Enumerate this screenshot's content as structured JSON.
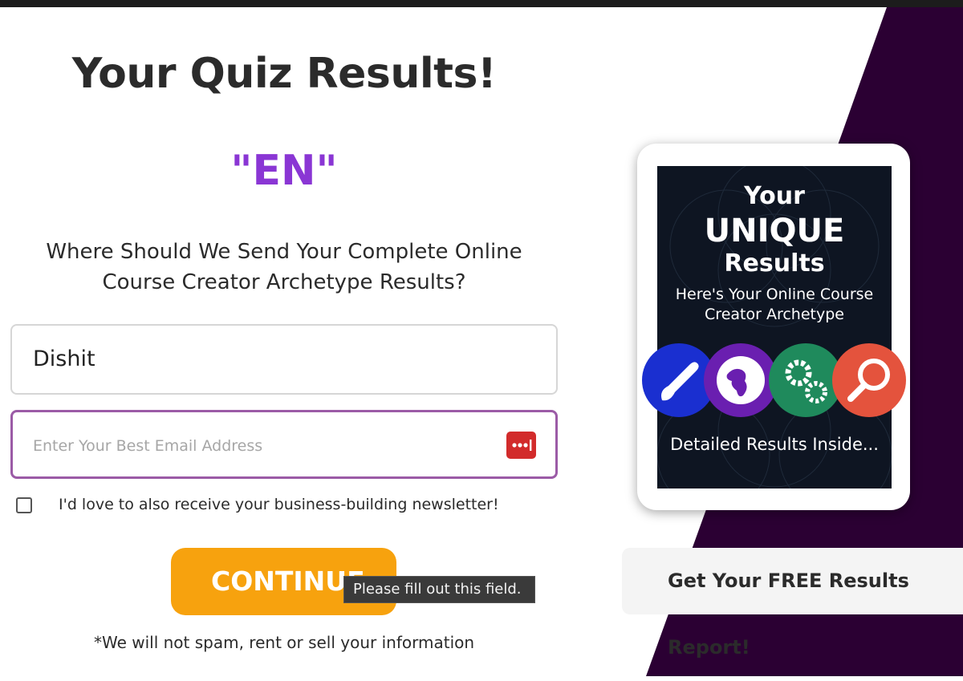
{
  "quiz": {
    "title": "Your Quiz Results!",
    "result_code": "\"EN\"",
    "question": "Where Should We Send Your Complete Online Course Creator Archetype Results?"
  },
  "form": {
    "name_value": "Dishit",
    "email_placeholder": "Enter Your Best Email Address",
    "newsletter_label": "I'd love to also receive your business-building newsletter!",
    "newsletter_checked": false,
    "continue_label": "CONTINUE",
    "validation_tooltip": "Please fill out this field.",
    "disclaimer": "*We will not spam, rent or sell your information"
  },
  "promo": {
    "tablet_line1": "Your",
    "tablet_line2": "UNIQUE",
    "tablet_line3": "Results",
    "tablet_subtitle": "Here's Your Online Course Creator Archetype",
    "tablet_footer": "Detailed Results Inside...",
    "icons": [
      "brush-icon",
      "globe-icon",
      "gears-icon",
      "magnifier-icon"
    ],
    "report_label": "Get Your FREE Results Report!"
  },
  "colors": {
    "accent_purple": "#8a36d4",
    "button_orange": "#f7a20e",
    "dark_purple": "#2b0033",
    "email_border": "#9b5ba6",
    "password_manager_red": "#d22b2b"
  }
}
